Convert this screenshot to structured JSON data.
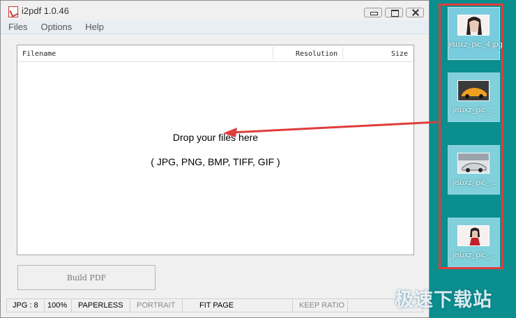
{
  "window": {
    "title": "i2pdf 1.0.46",
    "menu": [
      "Files",
      "Options",
      "Help"
    ]
  },
  "table": {
    "columns": [
      "Filename",
      "Resolution",
      "Size"
    ],
    "drop_line1": "Drop your files here",
    "drop_line2": "( JPG, PNG, BMP, TIFF, GIF )"
  },
  "build_button": "Build PDF",
  "statusbar": {
    "format": "JPG : 8",
    "zoom": "100%",
    "paperless": "PAPERLESS",
    "orientation": "PORTRAIT",
    "fit": "FIT PAGE",
    "ratio": "KEEP RATIO"
  },
  "desktop_icons": [
    {
      "label": "jisuxz_pic_4.jpg"
    },
    {
      "label": "jisuxz_pic_..."
    },
    {
      "label": "jisuxz_pic_..."
    },
    {
      "label": "jisuxz_pic_..."
    }
  ],
  "watermark": "极速下载站",
  "colors": {
    "highlight_box": "#e43a3a",
    "arrow": "#e03c3c",
    "desktop": "#0b8e8e"
  }
}
